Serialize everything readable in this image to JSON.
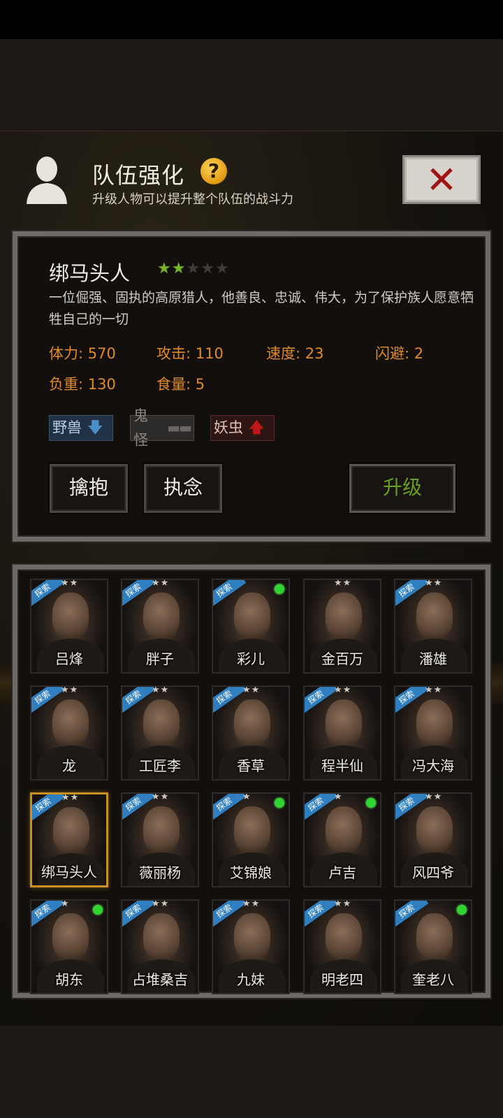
{
  "header": {
    "title": "队伍强化",
    "help_icon": "question-mark",
    "subtitle": "升级人物可以提升整个队伍的战斗力",
    "close_label": "✕"
  },
  "character": {
    "name": "绑马头人",
    "stars_filled": 2,
    "stars_total": 5,
    "description": "一位倔强、固执的高原猎人，他善良、忠诚、伟大，为了保护族人愿意牺牲自己的一切",
    "stats": {
      "hp": "体力: 570",
      "attack": "攻击: 110",
      "speed": "速度: 23",
      "dodge": "闪避: 2",
      "load": "负重: 130",
      "food": "食量: 5"
    },
    "tags": {
      "beast": "野兽",
      "ghost": "鬼怪",
      "insect": "妖虫"
    },
    "buttons": {
      "embrace": "擒抱",
      "obsess": "执念",
      "upgrade": "升级"
    }
  },
  "roster": [
    {
      "name": "吕烽",
      "badge": "探索",
      "stars": "★★",
      "online": false
    },
    {
      "name": "胖子",
      "badge": "探索",
      "stars": "★★",
      "online": false
    },
    {
      "name": "彩儿",
      "badge": "探索",
      "stars": "",
      "online": true
    },
    {
      "name": "金百万",
      "badge": "",
      "stars": "★★",
      "online": false
    },
    {
      "name": "潘雄",
      "badge": "探索",
      "stars": "★★",
      "online": false
    },
    {
      "name": "龙",
      "badge": "探索",
      "stars": "★★",
      "online": false
    },
    {
      "name": "工匠李",
      "badge": "探索",
      "stars": "★★",
      "online": false
    },
    {
      "name": "香草",
      "badge": "探索",
      "stars": "★★",
      "online": false
    },
    {
      "name": "程半仙",
      "badge": "探索",
      "stars": "★★",
      "online": false
    },
    {
      "name": "冯大海",
      "badge": "探索",
      "stars": "★★",
      "online": false
    },
    {
      "name": "绑马头人",
      "badge": "探索",
      "stars": "★★",
      "online": false,
      "selected": true
    },
    {
      "name": "薇丽杨",
      "badge": "探索",
      "stars": "★★",
      "online": false
    },
    {
      "name": "艾锦娘",
      "badge": "探索",
      "stars": "★",
      "online": true
    },
    {
      "name": "卢吉",
      "badge": "探索",
      "stars": "★",
      "online": true
    },
    {
      "name": "风四爷",
      "badge": "探索",
      "stars": "★★",
      "online": false
    },
    {
      "name": "胡东",
      "badge": "探索",
      "stars": "★",
      "online": true
    },
    {
      "name": "占堆桑吉",
      "badge": "探索",
      "stars": "★★",
      "online": false
    },
    {
      "name": "九妹",
      "badge": "探索",
      "stars": "★★",
      "online": false
    },
    {
      "name": "明老四",
      "badge": "探索",
      "stars": "★★",
      "online": false
    },
    {
      "name": "奎老八",
      "badge": "探索",
      "stars": "",
      "online": true
    }
  ],
  "colors": {
    "stat_text": "#e08a2a",
    "star_on": "#7ab32a",
    "upgrade_text": "#6aa020",
    "badge_blue": "#2f7fc0",
    "online_green": "#2fd42f",
    "selected_border": "#c89020"
  }
}
